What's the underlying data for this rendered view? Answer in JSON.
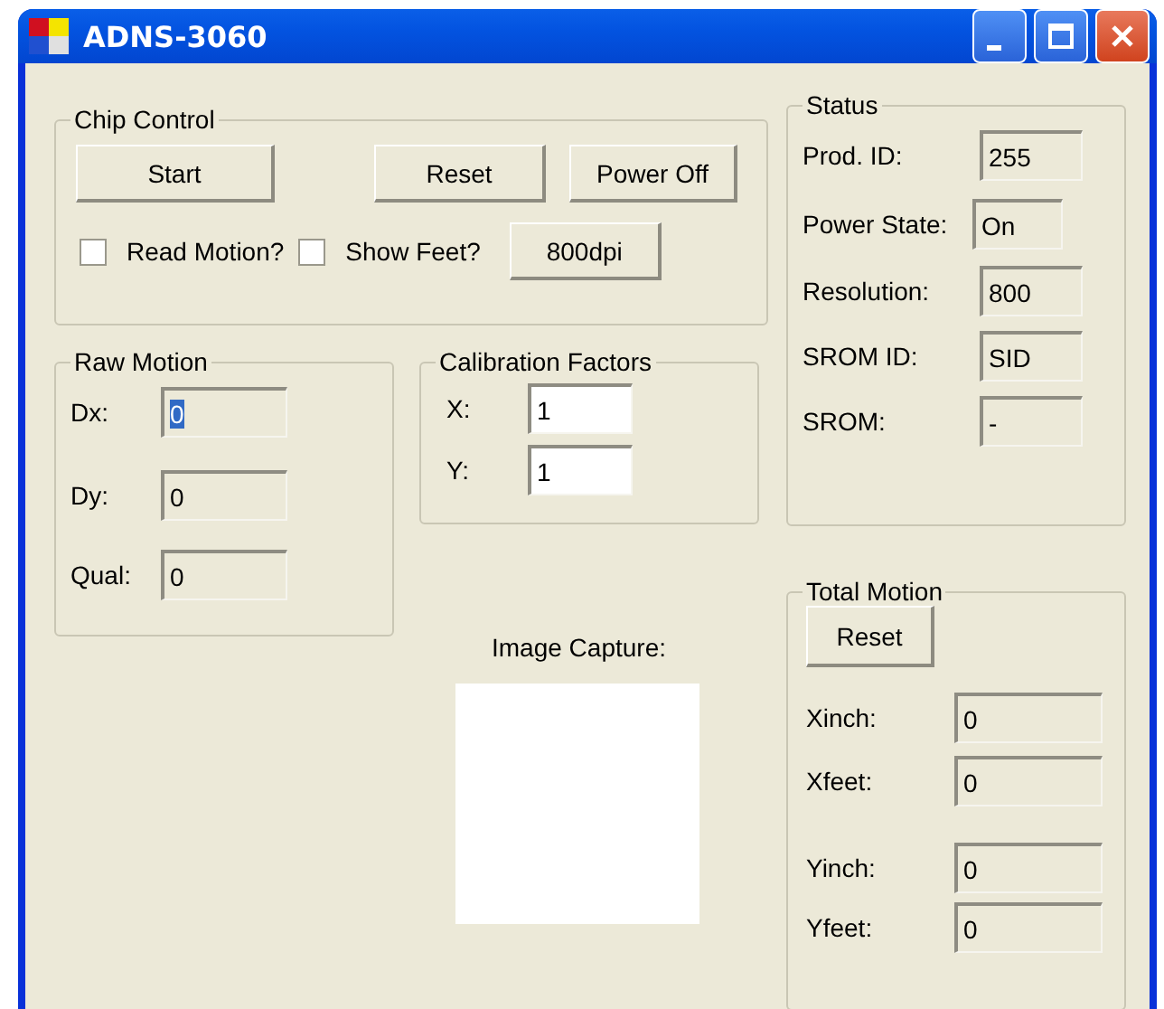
{
  "window": {
    "title": "ADNS-3060"
  },
  "chip_control": {
    "title": "Chip Control",
    "buttons": [
      "Start",
      "Reset",
      "Power Off"
    ],
    "checkboxes": [
      {
        "label": "Read Motion?",
        "checked": false
      },
      {
        "label": "Show Feet?",
        "checked": false
      }
    ],
    "resolution_button": "800dpi"
  },
  "raw_motion": {
    "title": "Raw Motion",
    "fields": [
      {
        "label": "Dx:",
        "value": "0",
        "highlighted": true
      },
      {
        "label": "Dy:",
        "value": "0",
        "highlighted": false
      },
      {
        "label": "Qual:",
        "value": "0",
        "highlighted": false
      }
    ]
  },
  "calibration": {
    "title": "Calibration Factors",
    "fields": [
      {
        "label": "X:",
        "value": "1"
      },
      {
        "label": "Y:",
        "value": "1"
      }
    ]
  },
  "image_capture": {
    "label": "Image Capture:"
  },
  "status": {
    "title": "Status",
    "fields": [
      {
        "label": "Prod. ID:",
        "value": "255"
      },
      {
        "label": "Power State:",
        "value": "On"
      },
      {
        "label": "Resolution:",
        "value": "800"
      },
      {
        "label": "SROM ID:",
        "value": "SID"
      },
      {
        "label": "SROM:",
        "value": "-"
      }
    ]
  },
  "total_motion": {
    "title": "Total Motion",
    "reset_button": "Reset",
    "fields": [
      {
        "label": "Xinch:",
        "value": "0"
      },
      {
        "label": "Xfeet:",
        "value": "0"
      },
      {
        "label": "Yinch:",
        "value": "0"
      },
      {
        "label": "Yfeet:",
        "value": "0"
      }
    ]
  }
}
